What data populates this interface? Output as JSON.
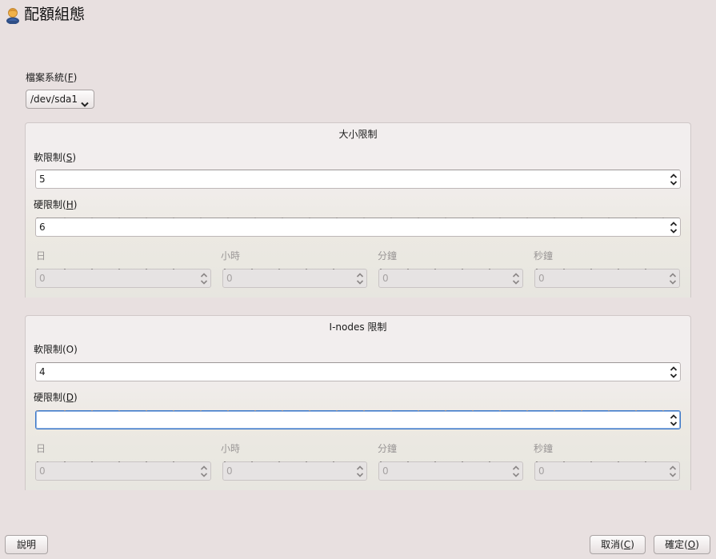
{
  "window": {
    "title": "配額組態",
    "icon": "user-icon"
  },
  "filesystem": {
    "label_text": "檔案系統(",
    "label_mnemonic": "F",
    "label_end": ")",
    "selected": "/dev/sda1"
  },
  "size_limits": {
    "title": "大小限制",
    "soft": {
      "label_text": "軟限制(",
      "label_mnemonic": "S",
      "label_end": ")",
      "value": "5"
    },
    "hard": {
      "label_text": "硬限制(",
      "label_mnemonic": "H",
      "label_end": ")",
      "value": "6"
    },
    "grace": {
      "labels": [
        "日",
        "小時",
        "分鐘",
        "秒鐘"
      ],
      "values": [
        "0",
        "0",
        "0",
        "0"
      ]
    }
  },
  "inode_limits": {
    "title": "I-nodes 限制",
    "soft": {
      "label_text": "軟限制(O)",
      "value": "4"
    },
    "hard": {
      "label_text": "硬限制(",
      "label_mnemonic": "D",
      "label_end": ")",
      "value": ""
    },
    "grace": {
      "labels": [
        "日",
        "小時",
        "分鐘",
        "秒鐘"
      ],
      "values": [
        "0",
        "0",
        "0",
        "0"
      ]
    }
  },
  "buttons": {
    "help": {
      "label": "說明"
    },
    "cancel": {
      "label_text": "取消(",
      "label_mnemonic": "C",
      "label_end": ")"
    },
    "ok": {
      "label_text": "確定(",
      "label_mnemonic": "O",
      "label_end": ")"
    }
  }
}
